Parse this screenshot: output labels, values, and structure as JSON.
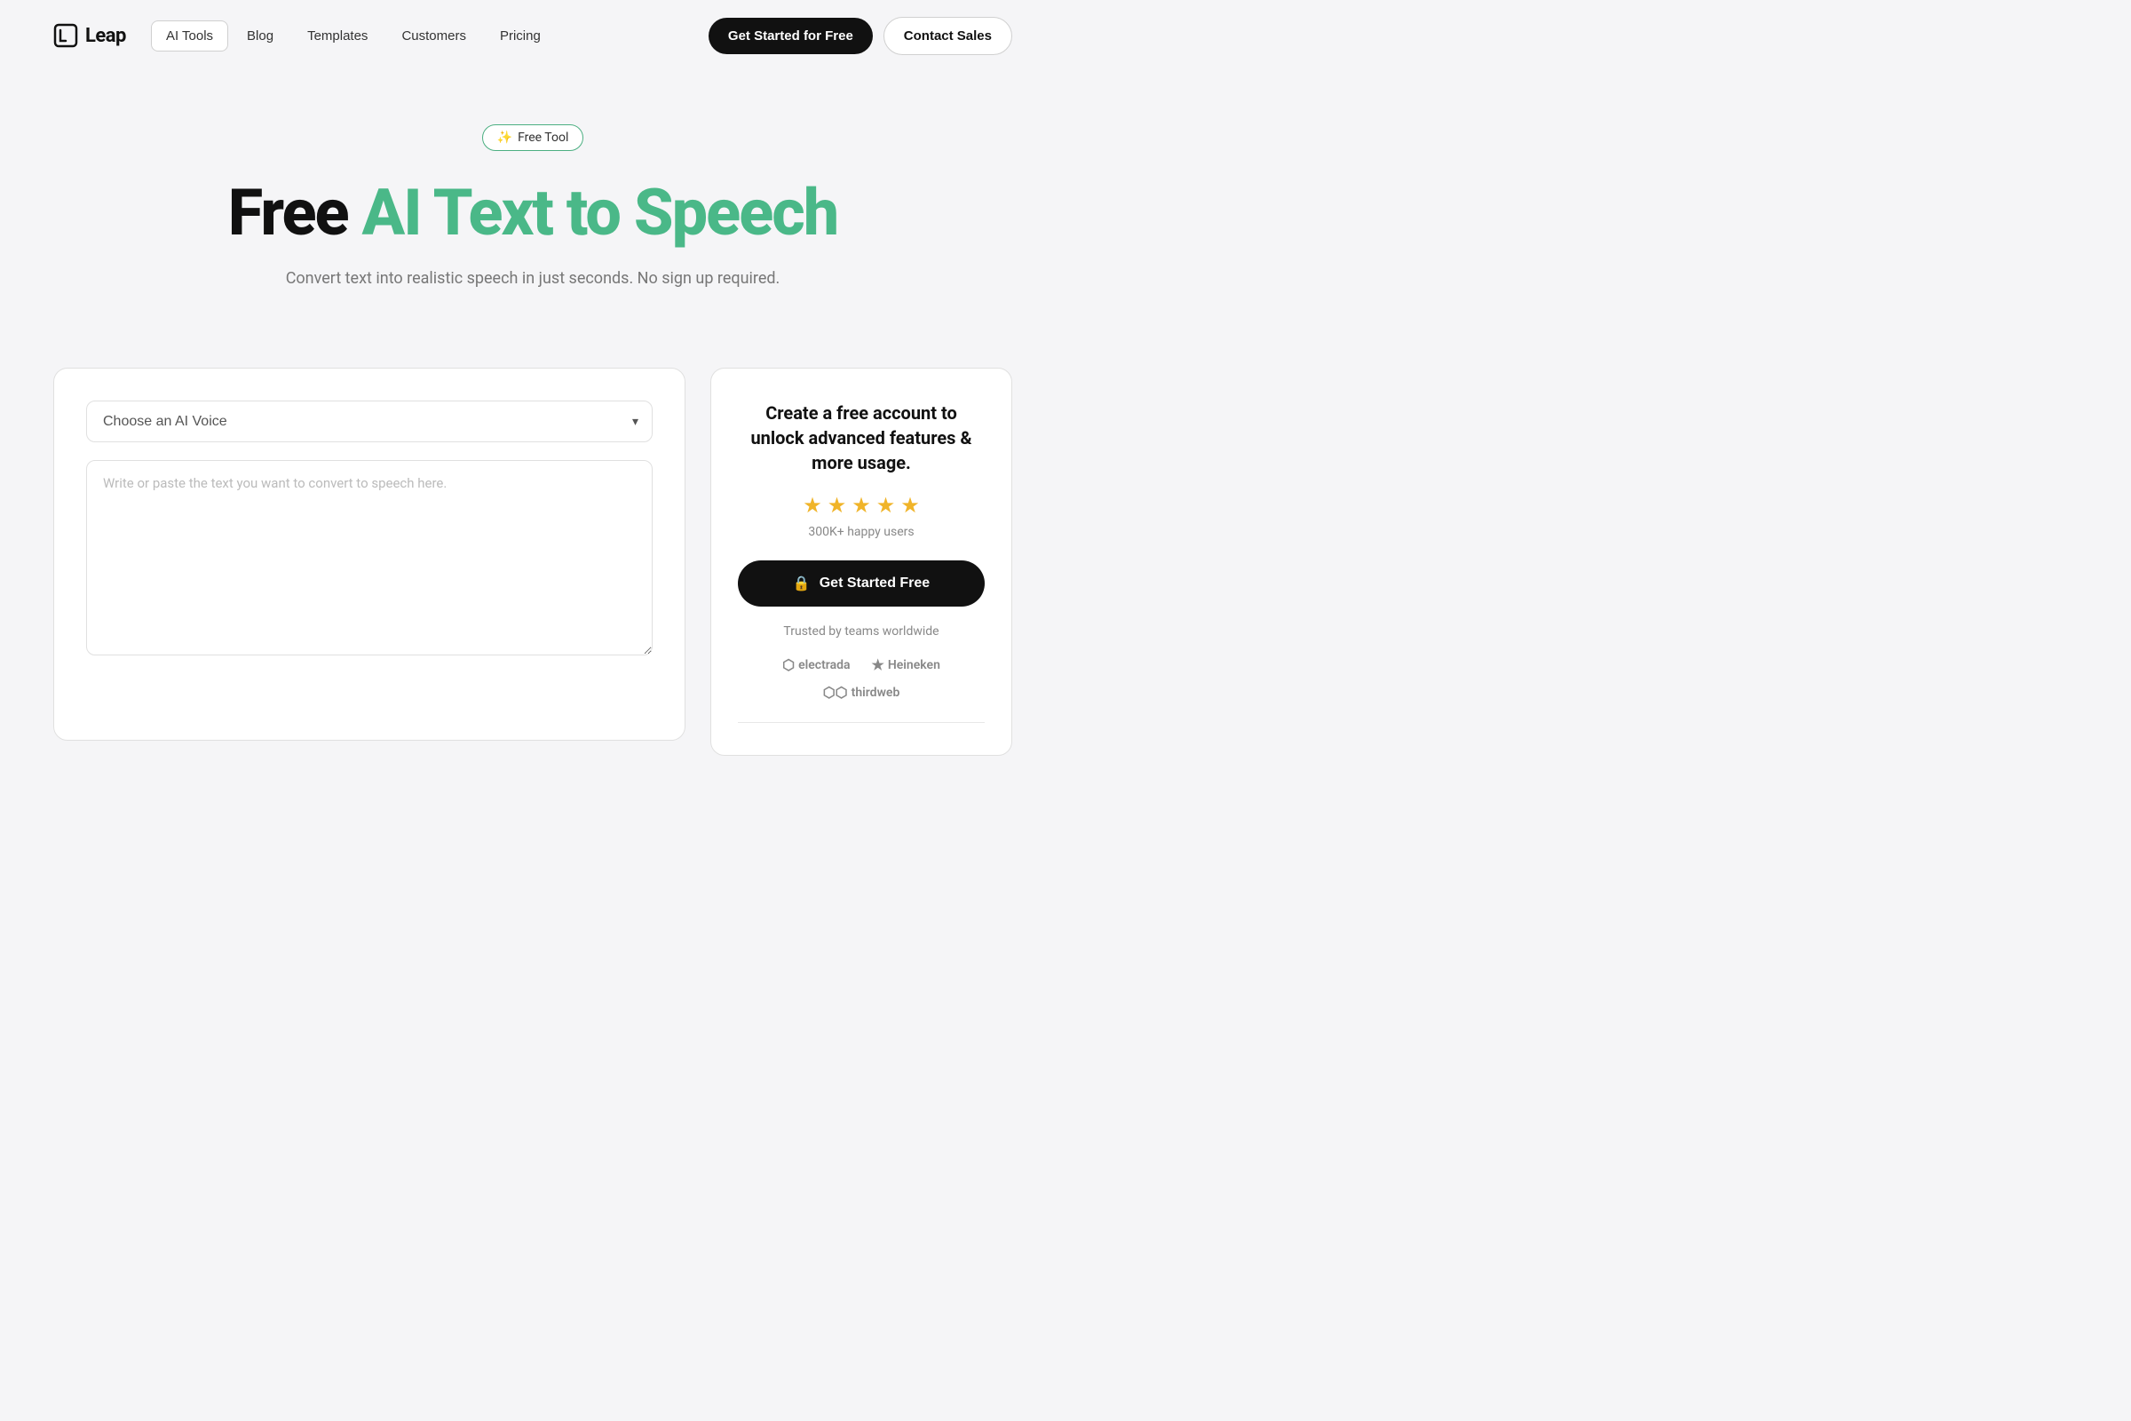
{
  "navbar": {
    "logo_text": "Leap",
    "nav_items": [
      {
        "label": "AI Tools",
        "active": true
      },
      {
        "label": "Blog",
        "active": false
      },
      {
        "label": "Templates",
        "active": false
      },
      {
        "label": "Customers",
        "active": false
      },
      {
        "label": "Pricing",
        "active": false
      }
    ],
    "cta_primary": "Get Started for Free",
    "cta_secondary": "Contact Sales"
  },
  "hero": {
    "badge_icon": "✨",
    "badge_text": "Free Tool",
    "title_black": "Free",
    "title_green": "AI Text to Speech",
    "subtitle": "Convert text into realistic speech in just seconds. No sign up required."
  },
  "voice_select": {
    "placeholder": "Choose an AI Voice"
  },
  "textarea": {
    "placeholder": "Write or paste the text you want to convert to speech here."
  },
  "right_panel": {
    "title": "Create a free account to unlock advanced features & more usage.",
    "stars_count": 5,
    "happy_users": "300K+ happy users",
    "cta_label": "Get Started Free",
    "trusted_text": "Trusted by teams worldwide",
    "companies": [
      {
        "name": "Electrada",
        "symbol": "⬡"
      },
      {
        "name": "Heineken",
        "symbol": "★"
      },
      {
        "name": "thirdweb",
        "symbol": "⬡⬡"
      }
    ]
  },
  "icons": {
    "chevron_down": "▾",
    "lock": "🔒",
    "logo_square": "▢"
  }
}
